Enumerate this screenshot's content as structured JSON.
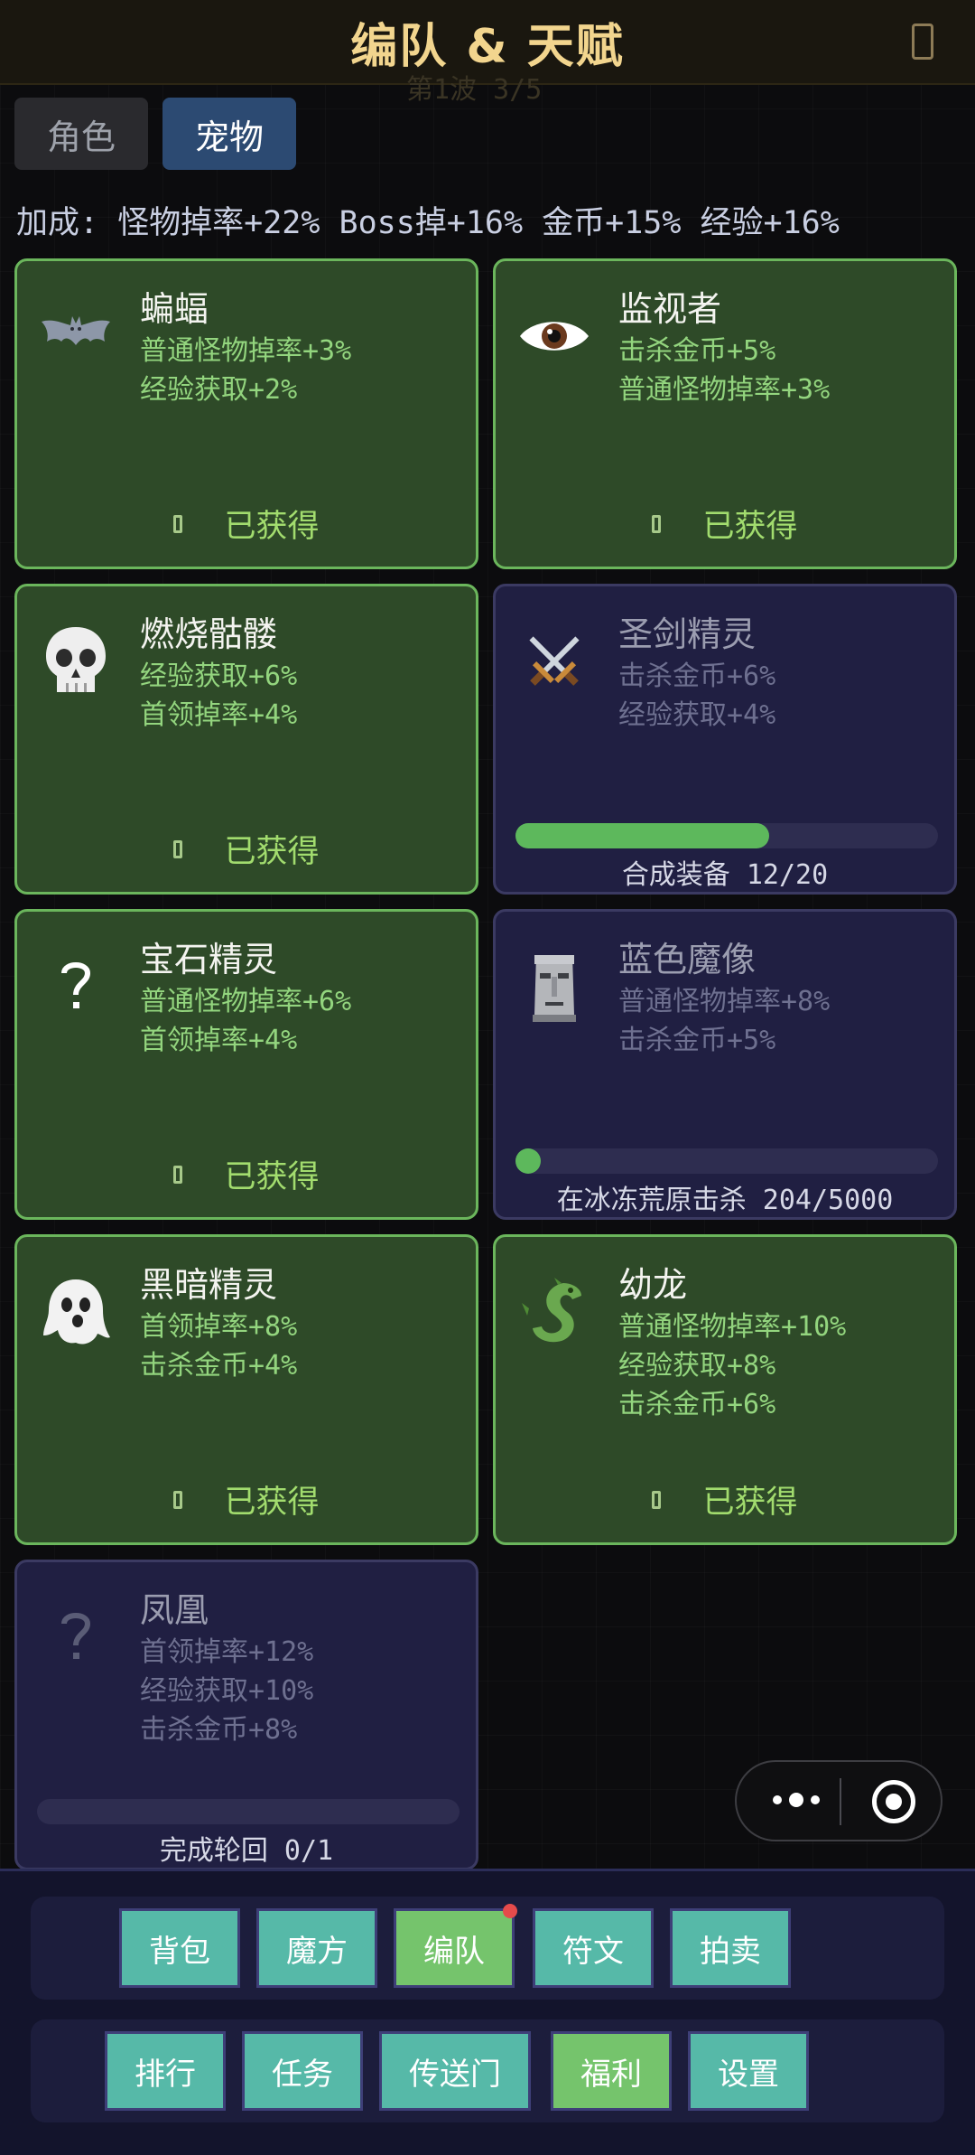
{
  "header": {
    "title": "编队 & 天赋",
    "ghost_text": "第1波  3/5"
  },
  "tabs": [
    {
      "label": "角色"
    },
    {
      "label": "宠物"
    }
  ],
  "bonus_text": "加成: 怪物掉率+22%  Boss掉+16%  金币+15%  经验+16%",
  "pets": [
    {
      "name": "蝙蝠",
      "icon": "bat-icon",
      "stats": [
        "普通怪物掉率+3%",
        "经验获取+2%"
      ],
      "status": "已获得"
    },
    {
      "name": "监视者",
      "icon": "eye-icon",
      "stats": [
        "击杀金币+5%",
        "普通怪物掉率+3%"
      ],
      "status": "已获得"
    },
    {
      "name": "燃烧骷髅",
      "icon": "skull-icon",
      "stats": [
        "经验获取+6%",
        "首领掉率+4%"
      ],
      "status": "已获得"
    },
    {
      "name": "圣剑精灵",
      "icon": "crossed-swords-icon",
      "stats": [
        "击杀金币+6%",
        "经验获取+4%"
      ],
      "progress_label": "合成装备 12/20",
      "progress": 0.6
    },
    {
      "name": "宝石精灵",
      "icon": "question-icon",
      "stats": [
        "普通怪物掉率+6%",
        "首领掉率+4%"
      ],
      "status": "已获得"
    },
    {
      "name": "蓝色魔像",
      "icon": "moai-icon",
      "stats": [
        "普通怪物掉率+8%",
        "击杀金币+5%"
      ],
      "progress_label": "在冰冻荒原击杀 204/5000",
      "progress": 0.0408
    },
    {
      "name": "黑暗精灵",
      "icon": "ghost-icon",
      "stats": [
        "首领掉率+8%",
        "击杀金币+4%"
      ],
      "status": "已获得"
    },
    {
      "name": "幼龙",
      "icon": "dragon-icon",
      "stats": [
        "普通怪物掉率+10%",
        "经验获取+8%",
        "击杀金币+6%"
      ],
      "status": "已获得"
    },
    {
      "name": "凤凰",
      "icon": "question-icon",
      "stats": [
        "首领掉率+12%",
        "经验获取+10%",
        "击杀金币+8%"
      ],
      "progress_label": "完成轮回 0/1",
      "progress": 0
    }
  ],
  "nav": {
    "row1": [
      "背包",
      "魔方",
      "编队",
      "符文",
      "拍卖"
    ],
    "row2": [
      "排行",
      "任务",
      "传送门",
      "福利",
      "设置"
    ]
  },
  "colors": {
    "owned_card": "#2e4a28",
    "owned_border": "#6bb65c",
    "locked_card": "#201f42",
    "nav_button": "#56b9a8",
    "nav_highlight": "#75c46c",
    "title": "#f2d58e",
    "notification_dot": "#e54b4b"
  }
}
